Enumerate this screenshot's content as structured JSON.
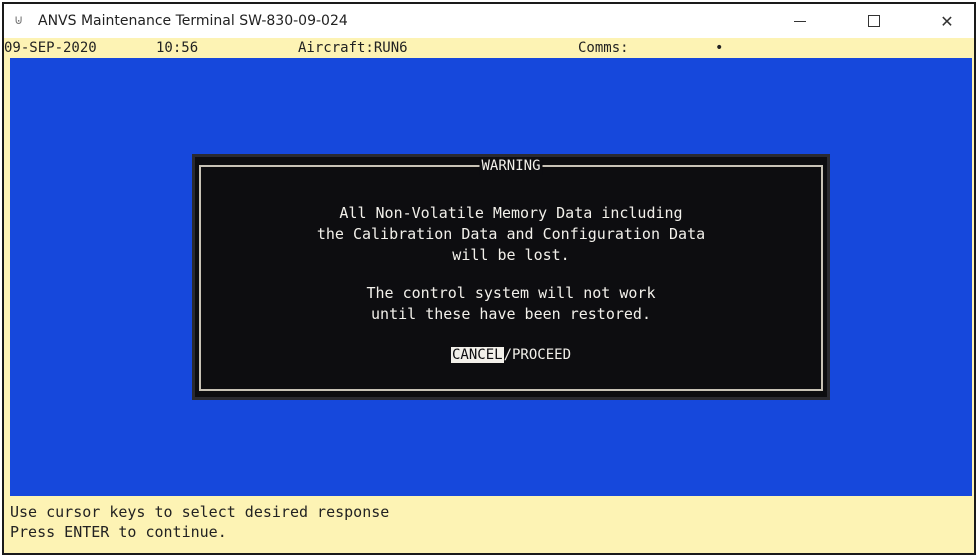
{
  "window": {
    "title": "ANVS Maintenance Terminal SW-830-09-024",
    "icon": "terminal-app-icon",
    "controls": {
      "minimize": "—",
      "maximize": "□",
      "close": "✕"
    }
  },
  "status": {
    "date": "09-SEP-2020",
    "time": "10:56",
    "aircraft": "Aircraft:RUN6",
    "comms_label": "Comms:",
    "comms_indicator": "•"
  },
  "dialog": {
    "title": "WARNING",
    "message_1": "All Non-Volatile Memory Data including\nthe Calibration Data and Configuration Data\nwill be lost.",
    "message_2": "The control system will not work\nuntil these have been restored.",
    "option_cancel": "CANCEL",
    "option_separator": "/",
    "option_proceed": "PROCEED"
  },
  "footer": {
    "line_1": "Use cursor keys to select desired response",
    "line_2": "Press ENTER to continue."
  },
  "colors": {
    "screen_bg": "#1648dc",
    "status_bg": "#fdf3b4",
    "dialog_bg": "#0d0d10",
    "dialog_text": "#f2f0ea"
  }
}
